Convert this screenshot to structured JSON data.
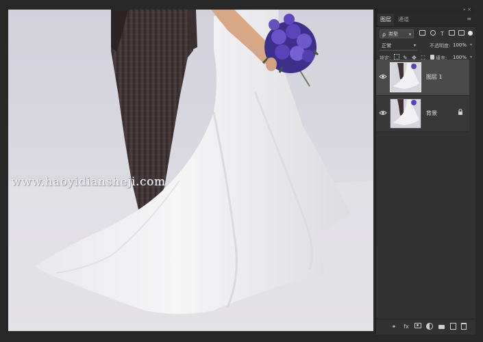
{
  "document": {
    "watermark": "www.haoyidiansheji.com",
    "photo_subject": "bride-and-groom-with-purple-bouquet"
  },
  "layers_panel": {
    "tabs": [
      {
        "label": "图层",
        "active": true
      },
      {
        "label": "通道",
        "active": false
      }
    ],
    "filter": {
      "kind": "类型",
      "icons": [
        "image-filter-icon",
        "adjustment-filter-icon",
        "type-filter-icon",
        "shape-filter-icon",
        "smart-object-filter-icon"
      ]
    },
    "blend_mode": "正常",
    "opacity_label": "不透明度:",
    "opacity_value": "100%",
    "lock_label": "锁定:",
    "fill_label": "填充:",
    "fill_value": "100%",
    "layers": [
      {
        "name": "图层 1",
        "visible": true,
        "selected": true,
        "locked": false
      },
      {
        "name": "背景",
        "visible": true,
        "selected": false,
        "locked": true
      }
    ],
    "footer_icons": [
      "link-layers-icon",
      "fx-icon",
      "add-mask-icon",
      "adjustment-layer-icon",
      "new-group-icon",
      "new-layer-icon",
      "delete-layer-icon"
    ],
    "fx_label": "fx"
  },
  "colors": {
    "panel_bg": "#323232",
    "selected_layer": "#4a4a4a",
    "workspace_bg": "#282828",
    "bouquet": "#5a3fb0"
  }
}
